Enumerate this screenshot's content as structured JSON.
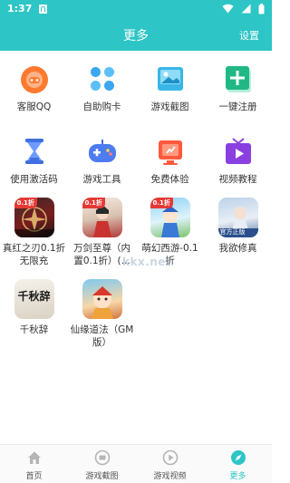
{
  "status_bar": {
    "time": "1:37"
  },
  "header": {
    "title": "更多",
    "settings_label": "设置"
  },
  "tools": [
    {
      "label": "客服QQ",
      "icon": "customer-service-icon"
    },
    {
      "label": "自助购卡",
      "icon": "card-purchase-icon"
    },
    {
      "label": "游戏截图",
      "icon": "screenshot-icon"
    },
    {
      "label": "一键注册",
      "icon": "register-icon"
    },
    {
      "label": "使用激活码",
      "icon": "hourglass-icon"
    },
    {
      "label": "游戏工具",
      "icon": "gamepad-icon"
    },
    {
      "label": "免费体验",
      "icon": "free-trial-icon"
    },
    {
      "label": "视频教程",
      "icon": "video-tutorial-icon"
    }
  ],
  "games": [
    {
      "label": "真红之刃0.1折无限充",
      "badge": "0.1折",
      "overlay": ""
    },
    {
      "label": "万剑至尊（内置0.1折）(...",
      "badge": "0.1折",
      "overlay": ""
    },
    {
      "label": "萌幻西游-0.1折",
      "badge": "0.1折",
      "overlay": ""
    },
    {
      "label": "我欲修真",
      "badge": "",
      "overlay": "官方正版"
    },
    {
      "label": "千秋辞",
      "badge": "",
      "overlay": "千秋辞"
    },
    {
      "label": "仙缘道法（GM版）",
      "badge": "",
      "overlay": ""
    }
  ],
  "watermark": "kkx.net",
  "tabs": [
    {
      "label": "首页",
      "icon": "home-icon"
    },
    {
      "label": "游戏截图",
      "icon": "screenshot-icon"
    },
    {
      "label": "游戏视频",
      "icon": "play-icon"
    },
    {
      "label": "更多",
      "icon": "compass-icon"
    }
  ],
  "colors": {
    "accent": "#2dc5c5",
    "background": "#ffffff"
  }
}
